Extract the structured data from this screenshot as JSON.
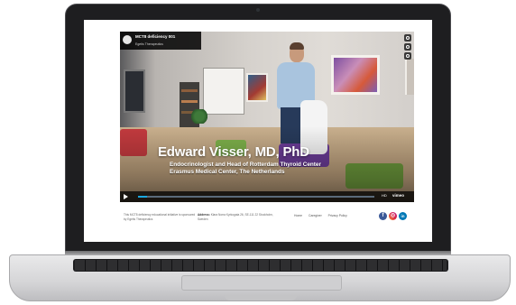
{
  "video": {
    "title": "MCT8 deficiency 001",
    "channel": "Egetis Therapeutics",
    "speaker_name": "Edward Visser, MD, PhD",
    "speaker_role_line1": "Endocrinologist and Head of Rotterdam Thyroid Center",
    "speaker_role_line2": "Erasmus Medical Center, The Netherlands",
    "progress": 0.04,
    "quality_label": "HD",
    "player_brand": "vimeo"
  },
  "footer": {
    "disclaimer": "This MCT8 deficiency educational initiative is sponsored by Egetis Therapeutics",
    "address_label": "Address:",
    "address_text": "Klara Norra Kyrkogata 26, SE-111 22 Stockholm, Sweden",
    "links": [
      "Home",
      "Caregiver",
      "Privacy Policy"
    ],
    "social": [
      "facebook-icon",
      "instagram-icon",
      "linkedin-icon"
    ]
  },
  "colors": {
    "progress": "#1aa7e0",
    "facebook": "#3b5998",
    "linkedin": "#0077b5"
  }
}
